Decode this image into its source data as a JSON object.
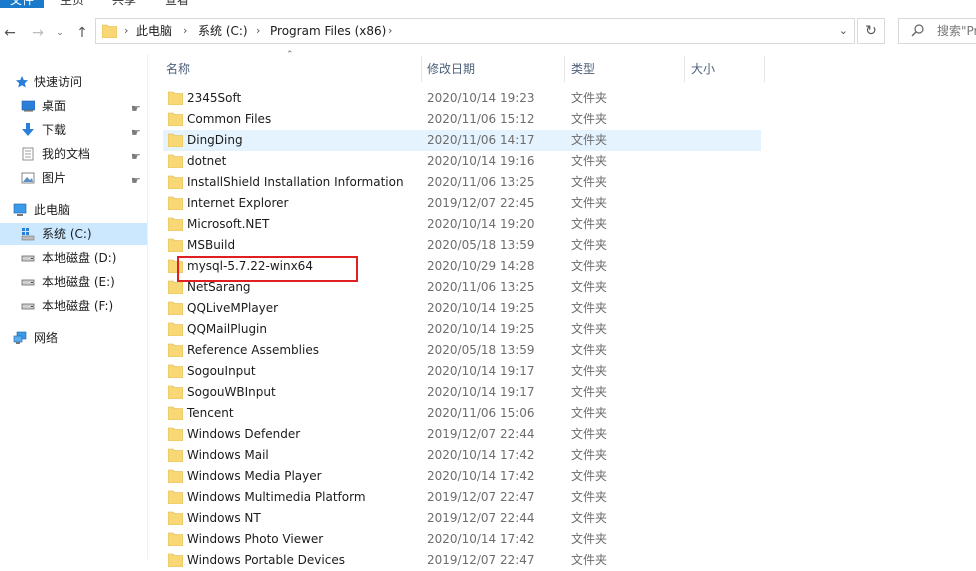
{
  "ribbon": {
    "tabs": [
      "文件",
      "主页",
      "共享",
      "查看"
    ]
  },
  "address": {
    "crumbs": [
      "此电脑",
      "系统 (C:)",
      "Program Files (x86)"
    ],
    "search_placeholder": "搜索\"Pr"
  },
  "sidebar": {
    "items": [
      {
        "label": "快速访问",
        "icon": "star-icon",
        "level": 0,
        "pinned": false,
        "selected": false
      },
      {
        "label": "桌面",
        "icon": "desktop-icon",
        "level": 1,
        "pinned": true,
        "selected": false
      },
      {
        "label": "下载",
        "icon": "download-icon",
        "level": 1,
        "pinned": true,
        "selected": false
      },
      {
        "label": "我的文档",
        "icon": "documents-icon",
        "level": 1,
        "pinned": true,
        "selected": false
      },
      {
        "label": "图片",
        "icon": "pictures-icon",
        "level": 1,
        "pinned": true,
        "selected": false
      },
      {
        "label": "此电脑",
        "icon": "computer-icon",
        "level": 0,
        "pinned": false,
        "selected": false
      },
      {
        "label": "系统 (C:)",
        "icon": "system-drive-icon",
        "level": 1,
        "pinned": false,
        "selected": true
      },
      {
        "label": "本地磁盘 (D:)",
        "icon": "drive-icon",
        "level": 1,
        "pinned": false,
        "selected": false
      },
      {
        "label": "本地磁盘 (E:)",
        "icon": "drive-icon",
        "level": 1,
        "pinned": false,
        "selected": false
      },
      {
        "label": "本地磁盘 (F:)",
        "icon": "drive-icon",
        "level": 1,
        "pinned": false,
        "selected": false
      },
      {
        "label": "网络",
        "icon": "network-icon",
        "level": 0,
        "pinned": false,
        "selected": false
      }
    ]
  },
  "columns": {
    "name": "名称",
    "date": "修改日期",
    "type": "类型",
    "size": "大小"
  },
  "files": [
    {
      "name": "2345Soft",
      "date": "2020/10/14 19:23",
      "type": "文件夹"
    },
    {
      "name": "Common Files",
      "date": "2020/11/06 15:12",
      "type": "文件夹"
    },
    {
      "name": "DingDing",
      "date": "2020/11/06 14:17",
      "type": "文件夹"
    },
    {
      "name": "dotnet",
      "date": "2020/10/14 19:16",
      "type": "文件夹"
    },
    {
      "name": "InstallShield Installation Information",
      "date": "2020/11/06 13:25",
      "type": "文件夹"
    },
    {
      "name": "Internet Explorer",
      "date": "2019/12/07 22:45",
      "type": "文件夹"
    },
    {
      "name": "Microsoft.NET",
      "date": "2020/10/14 19:20",
      "type": "文件夹"
    },
    {
      "name": "MSBuild",
      "date": "2020/05/18 13:59",
      "type": "文件夹"
    },
    {
      "name": "mysql-5.7.22-winx64",
      "date": "2020/10/29 14:28",
      "type": "文件夹"
    },
    {
      "name": "NetSarang",
      "date": "2020/11/06 13:25",
      "type": "文件夹"
    },
    {
      "name": "QQLiveMPlayer",
      "date": "2020/10/14 19:25",
      "type": "文件夹"
    },
    {
      "name": "QQMailPlugin",
      "date": "2020/10/14 19:25",
      "type": "文件夹"
    },
    {
      "name": "Reference Assemblies",
      "date": "2020/05/18 13:59",
      "type": "文件夹"
    },
    {
      "name": "SogouInput",
      "date": "2020/10/14 19:17",
      "type": "文件夹"
    },
    {
      "name": "SogouWBInput",
      "date": "2020/10/14 19:17",
      "type": "文件夹"
    },
    {
      "name": "Tencent",
      "date": "2020/11/06 15:06",
      "type": "文件夹"
    },
    {
      "name": "Windows Defender",
      "date": "2019/12/07 22:44",
      "type": "文件夹"
    },
    {
      "name": "Windows Mail",
      "date": "2020/10/14 17:42",
      "type": "文件夹"
    },
    {
      "name": "Windows Media Player",
      "date": "2020/10/14 17:42",
      "type": "文件夹"
    },
    {
      "name": "Windows Multimedia Platform",
      "date": "2019/12/07 22:47",
      "type": "文件夹"
    },
    {
      "name": "Windows NT",
      "date": "2019/12/07 22:44",
      "type": "文件夹"
    },
    {
      "name": "Windows Photo Viewer",
      "date": "2020/10/14 17:42",
      "type": "文件夹"
    },
    {
      "name": "Windows Portable Devices",
      "date": "2019/12/07 22:47",
      "type": "文件夹"
    }
  ],
  "hover_row": "DingDing",
  "highlighted_row": "mysql-5.7.22-winx64",
  "colors": {
    "accent": "#1979ca",
    "folder": "#f8d775",
    "highlight": "#e02020",
    "selection": "#cce8ff",
    "hover": "#e5f3ff"
  }
}
